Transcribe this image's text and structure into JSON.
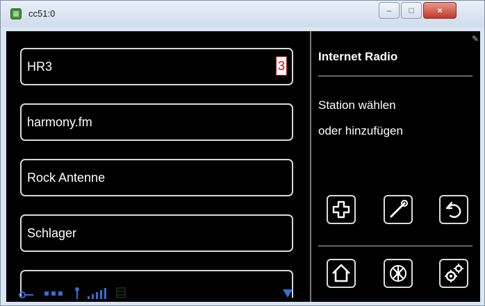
{
  "window": {
    "title": "cc51:0",
    "controls": {
      "minimize": "–",
      "maximize": "□",
      "close": "×"
    }
  },
  "stations": [
    {
      "label": "HR3",
      "badge": "3"
    },
    {
      "label": "harmony.fm"
    },
    {
      "label": "Rock Antenne"
    },
    {
      "label": "Schlager"
    }
  ],
  "panel": {
    "title": "Internet Radio",
    "line1": "Station wählen",
    "line2": "oder hinzufügen"
  },
  "icons": {
    "row1": [
      "add-icon",
      "wrench-icon",
      "back-icon"
    ],
    "row2": [
      "home-icon",
      "fan-icon",
      "gears-icon"
    ],
    "status": [
      "key-icon",
      "network-icon",
      "antenna-icon",
      "signal-icon",
      "grid-icon",
      "scroll-down-icon"
    ]
  },
  "colors": {
    "background": "#000000",
    "text": "#ffffff",
    "badge": "#e00000",
    "status": "#2f6fd6"
  }
}
